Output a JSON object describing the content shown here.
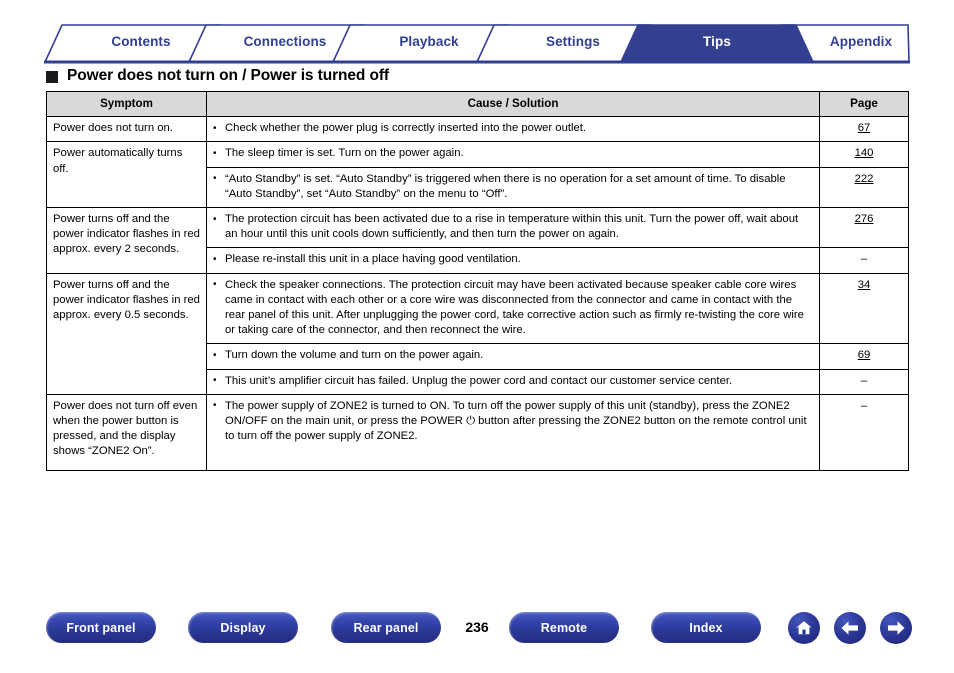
{
  "nav_tabs": [
    {
      "label": "Contents",
      "active": false
    },
    {
      "label": "Connections",
      "active": false
    },
    {
      "label": "Playback",
      "active": false
    },
    {
      "label": "Settings",
      "active": false
    },
    {
      "label": "Tips",
      "active": true
    },
    {
      "label": "Appendix",
      "active": false
    }
  ],
  "section": {
    "heading": "Power does not turn on / Power is turned off"
  },
  "table": {
    "headers": {
      "symptom": "Symptom",
      "cause": "Cause / Solution",
      "page": "Page"
    },
    "rows": [
      {
        "symptom": "Power does not turn on.",
        "items": [
          {
            "text": "Check whether the power plug is correctly inserted into the power outlet.",
            "page": "67"
          }
        ]
      },
      {
        "symptom": "Power automatically turns off.",
        "items": [
          {
            "text": "The sleep timer is set. Turn on the power again.",
            "page": "140"
          },
          {
            "text": "“Auto Standby” is set. “Auto Standby” is triggered when there is no operation for a set amount of time. To disable “Auto Standby”, set “Auto Standby” on the menu to “Off”.",
            "page": "222"
          }
        ]
      },
      {
        "symptom": "Power turns off and the power indicator flashes in red approx. every 2 seconds.",
        "items": [
          {
            "text": "The protection circuit has been activated due to a rise in temperature within this unit. Turn the power off, wait about an hour until this unit cools down sufficiently, and then turn the power on again.",
            "page": "276"
          },
          {
            "text": "Please re-install this unit in a place having good ventilation.",
            "page": "–"
          }
        ]
      },
      {
        "symptom": "Power turns off and the power indicator flashes in red approx. every 0.5 seconds.",
        "items": [
          {
            "text": "Check the speaker connections. The protection circuit may have been activated because speaker cable core wires came in contact with each other or a core wire was disconnected from the connector and came in contact with the rear panel of this unit. After unplugging the power cord, take corrective action such as firmly re-twisting the core wire or taking care of the connector, and then reconnect the wire.",
            "page": "34"
          },
          {
            "text": "Turn down the volume and turn on the power again.",
            "page": "69"
          },
          {
            "text": "This unit’s amplifier circuit has failed. Unplug the power cord and contact our customer service center.",
            "page": "–"
          }
        ]
      },
      {
        "symptom": "Power does not turn off even when the power button is pressed, and the display shows “ZONE2 On”.",
        "items": [
          {
            "text": "The power supply of ZONE2 is turned to ON. To turn off the power supply of this unit (standby), press the ZONE2 ON/OFF on the main unit, or press the POWER ⏻ button after pressing the ZONE2 button on the remote control unit to turn off the power supply of ZONE2.",
            "page": "–"
          }
        ]
      }
    ]
  },
  "footer": {
    "buttons": [
      {
        "label": "Front panel",
        "name": "front-panel-button"
      },
      {
        "label": "Display",
        "name": "display-button"
      },
      {
        "label": "Rear panel",
        "name": "rear-panel-button"
      },
      {
        "label": "Remote",
        "name": "remote-button"
      },
      {
        "label": "Index",
        "name": "index-button"
      }
    ],
    "page_number": "236",
    "icons": [
      {
        "name": "home-icon",
        "label": "Home"
      },
      {
        "name": "arrow-left-icon",
        "label": "Back"
      },
      {
        "name": "arrow-right-icon",
        "label": "Forward"
      }
    ]
  },
  "colors": {
    "brand_blue": "#2f3f92",
    "active_tab_bg": "#333f8f",
    "header_gray": "#d9d9d9"
  }
}
